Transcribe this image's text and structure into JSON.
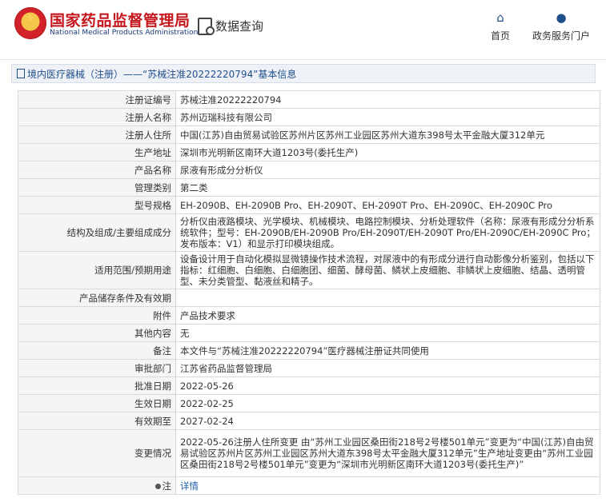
{
  "header": {
    "brand_cn": "国家药品监督管理局",
    "brand_en": "National Medical Products Administration",
    "query_label": "数据查询",
    "nav_home": "首页",
    "nav_portal": "政务服务门户"
  },
  "breadcrumb": "境内医疗器械（注册）——“苏械注准20222220794”基本信息",
  "rows": [
    {
      "label": "注册证编号",
      "value": "苏械注准20222220794"
    },
    {
      "label": "注册人名称",
      "value": "苏州迈瑞科技有限公司"
    },
    {
      "label": "注册人住所",
      "value": "中国(江苏)自由贸易试验区苏州片区苏州工业园区苏州大道东398号太平金融大厦312单元"
    },
    {
      "label": "生产地址",
      "value": "深圳市光明新区南环大道1203号(委托生产)"
    },
    {
      "label": "产品名称",
      "value": "尿液有形成分分析仪"
    },
    {
      "label": "管理类别",
      "value": "第二类"
    },
    {
      "label": "型号规格",
      "value": "EH-2090B、EH-2090B Pro、EH-2090T、EH-2090T Pro、EH-2090C、EH-2090C Pro"
    },
    {
      "label": "结构及组成/主要组成成分",
      "value": "分析仪由液路模块、光学模块、机械模块、电路控制模块、分析处理软件（名称：尿液有形成分分析系统软件；型号：EH-2090B/EH-2090B Pro/EH-2090T/EH-2090T Pro/EH-2090C/EH-2090C Pro；发布版本：V1）和显示打印模块组成。"
    },
    {
      "label": "适用范围/预期用途",
      "value": "设备设计用于自动化模拟显微镜操作技术流程，对尿液中的有形成分进行自动影像分析鉴别，包括以下指标：红细胞、白细胞、白细胞团、细菌、酵母菌、鳞状上皮细胞、非鳞状上皮细胞、结晶、透明管型、未分类管型、黏液丝和精子。"
    },
    {
      "label": "产品储存条件及有效期",
      "value": ""
    },
    {
      "label": "附件",
      "value": "产品技术要求"
    },
    {
      "label": "其他内容",
      "value": "无"
    },
    {
      "label": "备注",
      "value": "本文件与“苏械注准20222220794”医疗器械注册证共同使用"
    },
    {
      "label": "审批部门",
      "value": "江苏省药品监督管理局"
    },
    {
      "label": "批准日期",
      "value": "2022-05-26"
    },
    {
      "label": "生效日期",
      "value": "2022-02-25"
    },
    {
      "label": "有效期至",
      "value": "2027-02-24"
    },
    {
      "label": "变更情况",
      "value": "2022-05-26注册人住所变更 由“苏州工业园区桑田街218号2号楼501单元”变更为“中国(江苏)自由贸易试验区苏州片区苏州工业园区苏州大道东398号太平金融大厦312单元”生产地址变更由“苏州工业园区桑田街218号2号楼501单元”变更为“深圳市光明新区南环大道1203号(委托生产)”"
    }
  ],
  "note": {
    "label": "注",
    "link": "详情"
  }
}
